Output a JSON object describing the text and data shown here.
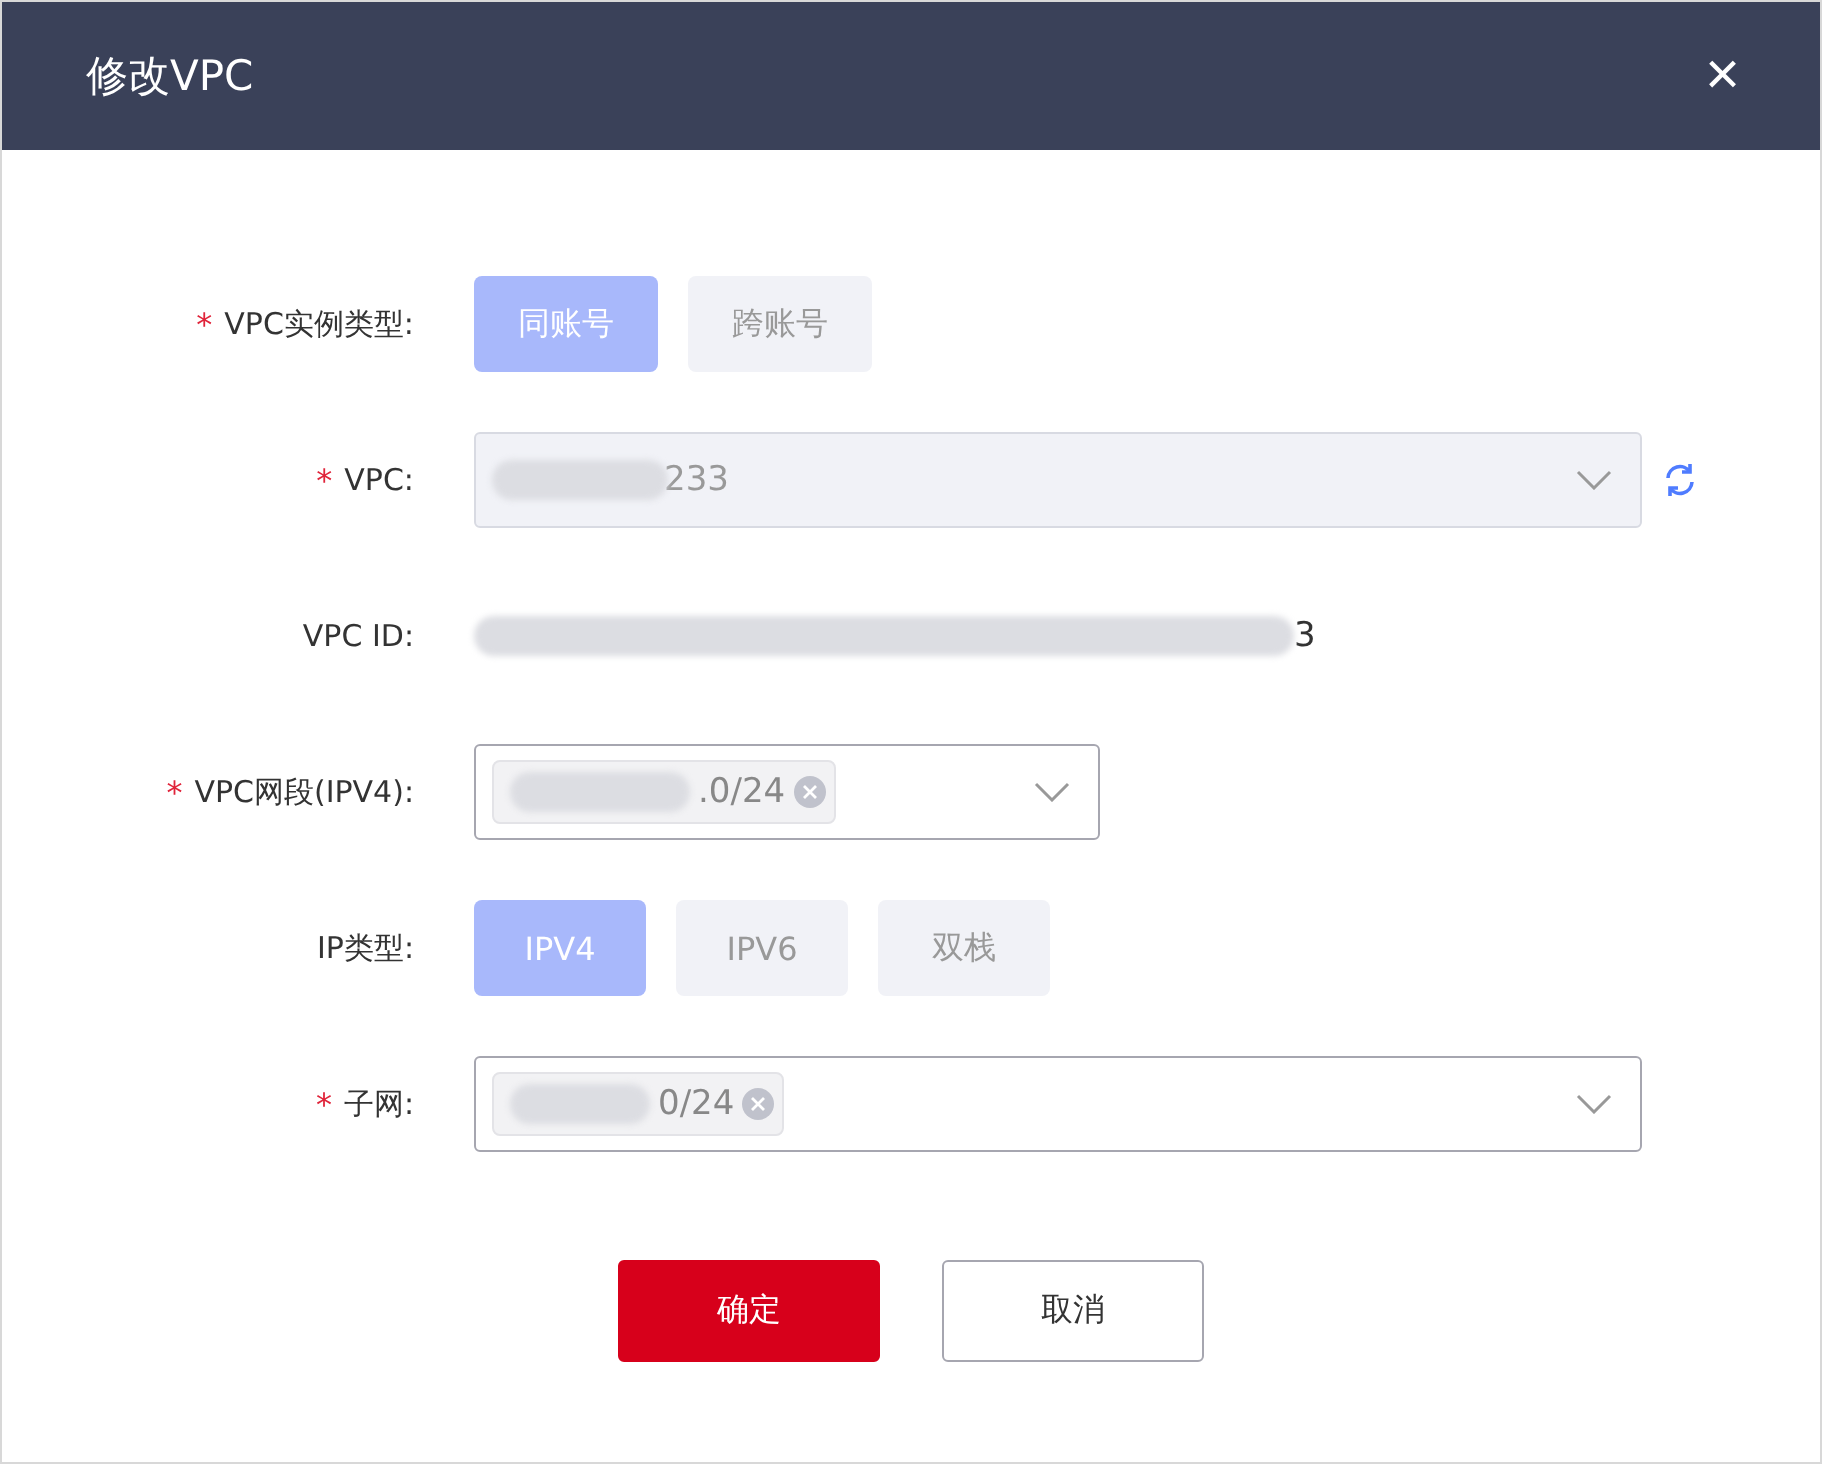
{
  "dialog": {
    "title": "修改VPC",
    "close": "×"
  },
  "form": [
    {
      "kind": "segmented",
      "label": "VPC实例类型:",
      "required_mark": "*",
      "options": [
        {
          "label": "同账号",
          "selected": true
        },
        {
          "label": "跨账号",
          "selected": false
        }
      ]
    },
    {
      "kind": "select",
      "label": "VPC:",
      "required_mark": "*",
      "value": "233",
      "disabled": true,
      "refresh": true
    },
    {
      "kind": "text",
      "label": "VPC ID:",
      "value": "3"
    },
    {
      "kind": "tags",
      "label": "VPC网段(IPV4):",
      "required_mark": "*",
      "narrow": true,
      "tags": [
        ".0/24"
      ]
    },
    {
      "kind": "segmented",
      "label": "IP类型:",
      "options": [
        {
          "label": "IPV4",
          "selected": true
        },
        {
          "label": "IPV6",
          "selected": false
        },
        {
          "label": "双栈",
          "selected": false
        }
      ]
    },
    {
      "kind": "tags",
      "label": "子网:",
      "required_mark": "*",
      "narrow": false,
      "tags": [
        "0/24"
      ]
    }
  ],
  "buttons": [
    {
      "label": "确定",
      "kind": "primary"
    },
    {
      "label": "取消",
      "kind": "default"
    }
  ]
}
